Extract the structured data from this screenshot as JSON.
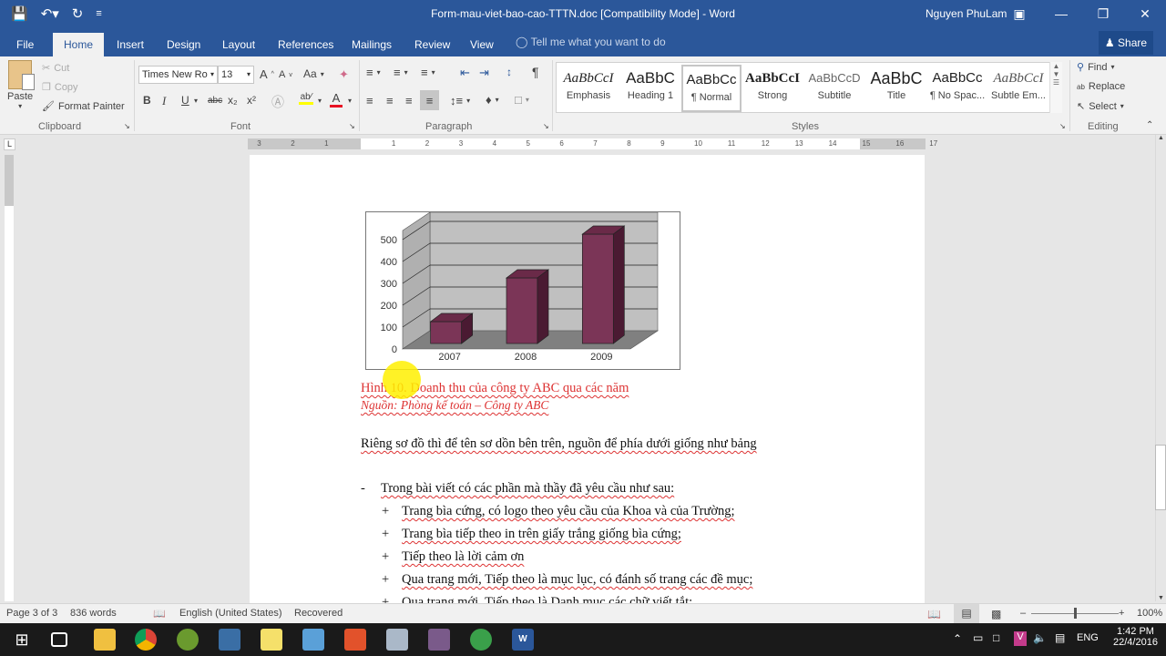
{
  "titlebar": {
    "doc_title": "Form-mau-viet-bao-cao-TTTN.doc [Compatibility Mode] - Word",
    "user": "Nguyen PhuLam",
    "qat": {
      "save_icon": "save-icon",
      "undo_icon": "undo-icon",
      "redo_icon": "redo-icon",
      "customize_icon": "customize-icon"
    }
  },
  "tabs": [
    {
      "label": "File"
    },
    {
      "label": "Home"
    },
    {
      "label": "Insert"
    },
    {
      "label": "Design"
    },
    {
      "label": "Layout"
    },
    {
      "label": "References"
    },
    {
      "label": "Mailings"
    },
    {
      "label": "Review"
    },
    {
      "label": "View"
    }
  ],
  "tellme": "Tell me what you want to do",
  "share": "Share",
  "clipboard": {
    "paste": "Paste",
    "cut": "Cut",
    "copy": "Copy",
    "format_painter": "Format Painter",
    "label": "Clipboard"
  },
  "font": {
    "name": "Times New Ro",
    "size": "13",
    "label": "Font",
    "bold": "B",
    "italic": "I",
    "underline": "U",
    "strike": "abc",
    "sub": "x₂",
    "sup": "x²",
    "grow": "A",
    "shrink": "A",
    "case": "Aa",
    "highlight_color": "#ffff00",
    "font_color": "#e81123"
  },
  "paragraph": {
    "label": "Paragraph",
    "pilcrow": "¶"
  },
  "styles": {
    "label": "Styles",
    "items": [
      {
        "preview": "AaBbCcI",
        "name": "Emphasis"
      },
      {
        "preview": "AaBbC",
        "name": "Heading 1"
      },
      {
        "preview": "AaBbCc",
        "name": "¶ Normal"
      },
      {
        "preview": "AaBbCcI",
        "name": "Strong"
      },
      {
        "preview": "AaBbCcD",
        "name": "Subtitle"
      },
      {
        "preview": "AaBbC",
        "name": "Title"
      },
      {
        "preview": "AaBbCc",
        "name": "¶ No Spac..."
      },
      {
        "preview": "AaBbCcI",
        "name": "Subtle Em..."
      }
    ]
  },
  "editing": {
    "find": "Find",
    "replace": "Replace",
    "select": "Select",
    "label": "Editing"
  },
  "ruler": {
    "left_ticks": [
      "3",
      "2",
      "1"
    ],
    "ticks": [
      "1",
      "2",
      "3",
      "4",
      "5",
      "6",
      "7",
      "8",
      "9",
      "10",
      "11",
      "12",
      "13",
      "14",
      "15",
      "16",
      "17"
    ]
  },
  "document": {
    "caption": "Hình 10. Doanh thu của công ty ABC qua các năm",
    "source": "Nguồn: Phòng kế toán – Công ty ABC",
    "para1": "Riêng sơ đồ thì để tên sơ dồn bên trên, nguồn để phía dưới giống như bảng",
    "list_intro_bullet": "-",
    "list_intro": "Trong bài viết có các phần mà thầy đã yêu cầu như sau:",
    "items": [
      "Trang bìa cứng, có logo theo yêu cầu của Khoa và của Trường;",
      "Trang bìa tiếp theo in trên giấy trắng giống bìa cứng;",
      "Tiếp theo là lời cảm ơn",
      "Qua trang mới, Tiếp theo là mục lục, có đánh số trang các đề mục;",
      "Qua trang mới, Tiếp theo là Danh mục các chữ viết tắt;"
    ],
    "item_bullet": "+"
  },
  "chart_data": {
    "type": "bar",
    "title": "",
    "categories": [
      "2007",
      "2008",
      "2009"
    ],
    "values": [
      100,
      300,
      500
    ],
    "ylim": [
      0,
      500
    ],
    "yticks": [
      "0",
      "100",
      "200",
      "300",
      "400",
      "500"
    ],
    "xlabel": "",
    "ylabel": "",
    "grid": true,
    "bar_color": "#7b3557",
    "wall_color": "#c0c0c0",
    "floor_color": "#808080",
    "style": "3d-column"
  },
  "status": {
    "page": "Page 3 of 3",
    "words": "836 words",
    "language": "English (United States)",
    "recovered": "Recovered",
    "zoom": "100%",
    "zoom_level": 100
  },
  "taskbar": {
    "time": "1:42 PM",
    "date": "22/4/2016",
    "lang": "ENG"
  }
}
